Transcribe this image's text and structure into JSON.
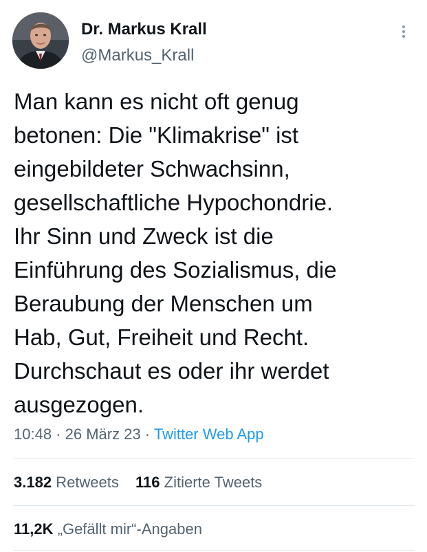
{
  "author": {
    "display_name": "Dr. Markus Krall",
    "handle": "@Markus_Krall"
  },
  "tweet": {
    "lines": [
      "Man kann es nicht oft genug",
      "betonen: Die \"Klimakrise\" ist",
      "eingebildeter Schwachsinn,",
      "gesellschaftliche Hypochondrie.",
      "Ihr Sinn und Zweck ist die",
      "Einführung des Sozialismus, die",
      "Beraubung der Menschen um",
      "Hab, Gut, Freiheit und Recht.",
      "Durchschaut es oder ihr werdet",
      "ausgezogen."
    ],
    "time": "10:48",
    "separator": " · ",
    "date": "26 März 23",
    "source": "Twitter Web App"
  },
  "stats": {
    "retweets": {
      "count": "3.182",
      "label": "Retweets"
    },
    "quotes": {
      "count": "116",
      "label": "Zitierte Tweets"
    },
    "likes": {
      "count": "11,2K",
      "label": "„Gefällt mir“-Angaben"
    }
  },
  "icons": {
    "more": "more-vertical-icon"
  },
  "colors": {
    "text": "#0f1419",
    "secondary": "#536471",
    "link": "#1d9bf0",
    "divider": "#e1e8ed"
  }
}
